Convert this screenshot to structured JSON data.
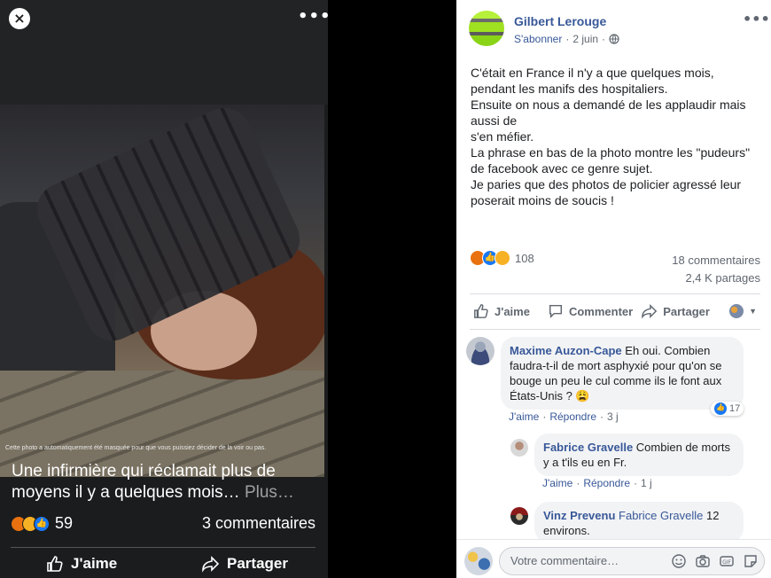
{
  "viewer": {
    "close_label": "×",
    "more_label": "•••",
    "masked_notice": "Cette photo a automatiquement été masquée pour que vous puissiez décider de la voir ou pas.",
    "caption": "Une infirmière qui réclamait plus de moyens il y a quelques mois…",
    "caption_more": "Plus…",
    "reaction_count": "59",
    "comments_count": "3 commentaires",
    "like_label": "J'aime",
    "share_label": "Partager"
  },
  "post": {
    "author": "Gilbert Lerouge",
    "subscribe": "S'abonner",
    "dot": "·",
    "date": "2 juin",
    "more_label": "•••",
    "lines": [
      "C'était en France il n'y a que quelques mois,",
      "pendant les manifs des hospitaliers.",
      "Ensuite on nous a demandé de les applaudir mais",
      "aussi de",
      "s'en méfier.",
      "La phrase en bas de la photo montre les \"pudeurs\"",
      "de facebook avec ce genre sujet.",
      "Je paries que des photos de policier agressé leur",
      "poserait moins de soucis !"
    ],
    "reaction_count": "108",
    "comments_count": "18 commentaires",
    "shares_count": "2,4 K partages",
    "actions": {
      "like": "J'aime",
      "comment": "Commenter",
      "share": "Partager"
    }
  },
  "comments": [
    {
      "name": "Maxime Auzon-Cape",
      "text_first": " Eh oui. Combien",
      "text_rest": "faudra-t-il de mort asphyxié pour qu'on se bouge un peu le cul comme ils le font aux États-Unis ? 😩",
      "like": "J'aime",
      "reply": "Répondre",
      "time": "3 j",
      "likes": "17"
    },
    {
      "name": "Fabrice Gravelle",
      "text_first": " Combien de morts",
      "text_rest": "y a t'ils eu en Fr.",
      "like": "J'aime",
      "reply": "Répondre",
      "time": "1 j"
    },
    {
      "name": "Vinz Prevenu",
      "mention": "Fabrice Gravelle",
      "text_first": " 12",
      "text_rest": "environs."
    }
  ],
  "composer": {
    "placeholder": "Votre commentaire…"
  },
  "colors": {
    "link": "#385898",
    "like_blue": "#1877f2",
    "angry": "#e9710f",
    "sad": "#f7b125"
  }
}
